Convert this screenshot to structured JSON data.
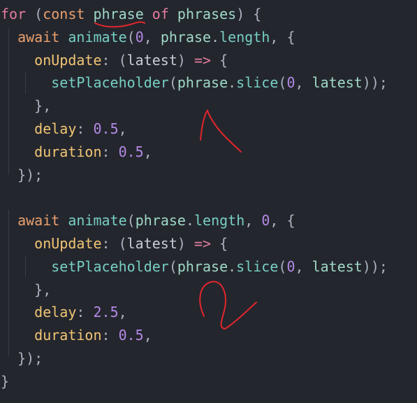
{
  "code": {
    "lines": [
      [
        [
          "for",
          "kw"
        ],
        [
          " (",
          "punc"
        ],
        [
          "const",
          "kw2"
        ],
        [
          " ",
          "plain"
        ],
        [
          "phrase",
          "var"
        ],
        [
          " ",
          "plain"
        ],
        [
          "of",
          "kw"
        ],
        [
          " ",
          "plain"
        ],
        [
          "phrases",
          "var"
        ],
        [
          ") {",
          "punc"
        ]
      ],
      [
        [
          "  ",
          "plain"
        ],
        [
          "await",
          "kw2"
        ],
        [
          " ",
          "plain"
        ],
        [
          "animate",
          "fn"
        ],
        [
          "(",
          "punc"
        ],
        [
          "0",
          "num"
        ],
        [
          ", ",
          "punc"
        ],
        [
          "phrase",
          "var"
        ],
        [
          ".",
          "punc"
        ],
        [
          "length",
          "fn"
        ],
        [
          ", {",
          "punc"
        ]
      ],
      [
        [
          "    ",
          "plain"
        ],
        [
          "onUpdate",
          "prop"
        ],
        [
          ": (",
          "punc"
        ],
        [
          "latest",
          "plain"
        ],
        [
          ") ",
          "punc"
        ],
        [
          "=>",
          "kw"
        ],
        [
          " {",
          "punc"
        ]
      ],
      [
        [
          "      ",
          "plain"
        ],
        [
          "setPlaceholder",
          "fn"
        ],
        [
          "(",
          "punc"
        ],
        [
          "phrase",
          "var"
        ],
        [
          ".",
          "punc"
        ],
        [
          "slice",
          "fn"
        ],
        [
          "(",
          "punc"
        ],
        [
          "0",
          "num"
        ],
        [
          ", ",
          "punc"
        ],
        [
          "latest",
          "var"
        ],
        [
          "));",
          "punc"
        ]
      ],
      [
        [
          "    },",
          "punc"
        ]
      ],
      [
        [
          "    ",
          "plain"
        ],
        [
          "delay",
          "prop"
        ],
        [
          ": ",
          "punc"
        ],
        [
          "0.5",
          "num"
        ],
        [
          ",",
          "punc"
        ]
      ],
      [
        [
          "    ",
          "plain"
        ],
        [
          "duration",
          "prop"
        ],
        [
          ": ",
          "punc"
        ],
        [
          "0.5",
          "num"
        ],
        [
          ",",
          "punc"
        ]
      ],
      [
        [
          "  });",
          "punc"
        ]
      ],
      [
        [
          "",
          "plain"
        ]
      ],
      [
        [
          "  ",
          "plain"
        ],
        [
          "await",
          "kw2"
        ],
        [
          " ",
          "plain"
        ],
        [
          "animate",
          "fn"
        ],
        [
          "(",
          "punc"
        ],
        [
          "phrase",
          "var"
        ],
        [
          ".",
          "punc"
        ],
        [
          "length",
          "fn"
        ],
        [
          ", ",
          "punc"
        ],
        [
          "0",
          "num"
        ],
        [
          ", {",
          "punc"
        ]
      ],
      [
        [
          "    ",
          "plain"
        ],
        [
          "onUpdate",
          "prop"
        ],
        [
          ": (",
          "punc"
        ],
        [
          "latest",
          "plain"
        ],
        [
          ") ",
          "punc"
        ],
        [
          "=>",
          "kw"
        ],
        [
          " {",
          "punc"
        ]
      ],
      [
        [
          "      ",
          "plain"
        ],
        [
          "setPlaceholder",
          "fn"
        ],
        [
          "(",
          "punc"
        ],
        [
          "phrase",
          "var"
        ],
        [
          ".",
          "punc"
        ],
        [
          "slice",
          "fn"
        ],
        [
          "(",
          "punc"
        ],
        [
          "0",
          "num"
        ],
        [
          ", ",
          "punc"
        ],
        [
          "latest",
          "var"
        ],
        [
          "));",
          "punc"
        ]
      ],
      [
        [
          "    },",
          "punc"
        ]
      ],
      [
        [
          "    ",
          "plain"
        ],
        [
          "delay",
          "prop"
        ],
        [
          ": ",
          "punc"
        ],
        [
          "2.5",
          "num"
        ],
        [
          ",",
          "punc"
        ]
      ],
      [
        [
          "    ",
          "plain"
        ],
        [
          "duration",
          "prop"
        ],
        [
          ": ",
          "punc"
        ],
        [
          "0.5",
          "num"
        ],
        [
          ",",
          "punc"
        ]
      ],
      [
        [
          "  });",
          "punc"
        ]
      ],
      [
        [
          "}",
          "punc"
        ]
      ]
    ]
  },
  "annotations": {
    "color": "#e0262b",
    "marks": [
      "underline-phrase",
      "handwritten-1",
      "handwritten-2"
    ]
  },
  "colors": {
    "background": "#24262e",
    "keyword": "#e27ca0",
    "await": "#e9a06e",
    "function": "#77cfc2",
    "property": "#f0c674",
    "number": "#b48ae6"
  }
}
